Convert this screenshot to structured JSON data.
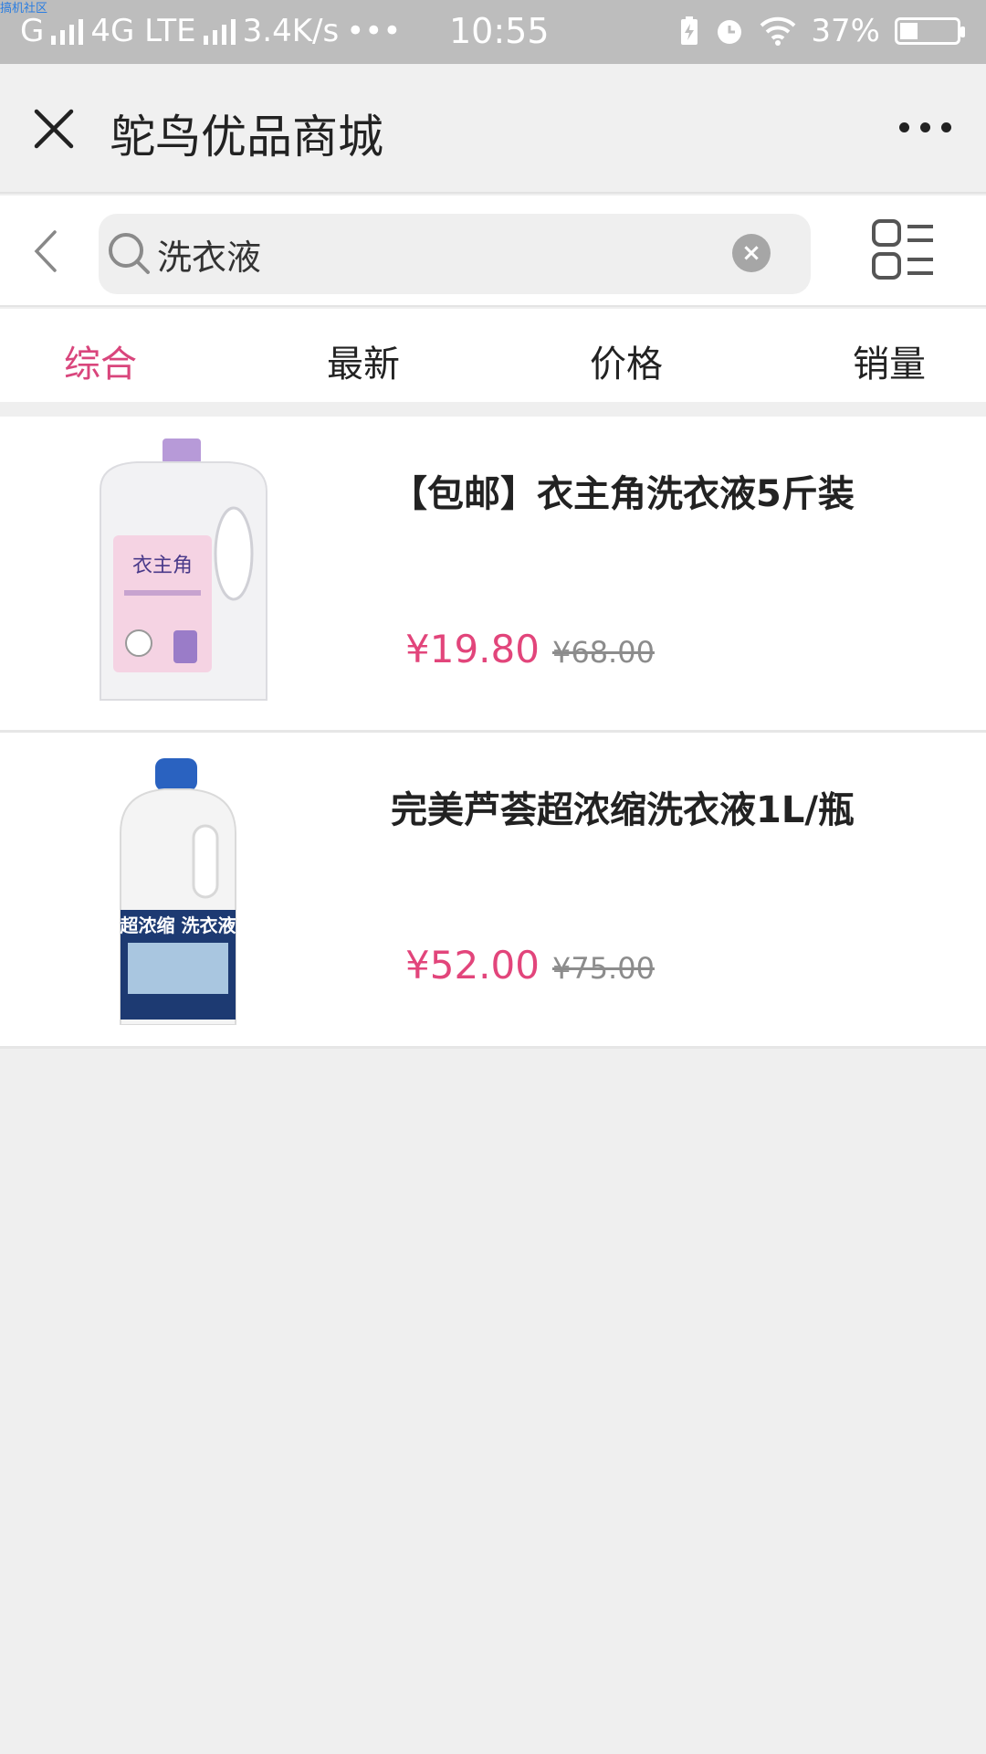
{
  "status_bar": {
    "watermark": "搞机社区",
    "carrier": "G",
    "network": "4G LTE",
    "speed": "3.4K/s",
    "dots": "•••",
    "time": "10:55",
    "battery": "37%"
  },
  "header": {
    "title": "鸵鸟优品商城"
  },
  "search": {
    "value": "洗衣液",
    "clear_label": "×"
  },
  "sort_tabs": [
    {
      "label": "综合",
      "active": true
    },
    {
      "label": "最新",
      "active": false
    },
    {
      "label": "价格",
      "active": false
    },
    {
      "label": "销量",
      "active": false
    }
  ],
  "products": [
    {
      "title": "【包邮】衣主角洗衣液5斤装",
      "price": "¥19.80",
      "original_price": "¥68.00",
      "image_text": "衣主角"
    },
    {
      "title": "完美芦荟超浓缩洗衣液1L/瓶",
      "price": "¥52.00",
      "original_price": "¥75.00",
      "image_text": "超浓缩 洗衣液"
    }
  ],
  "colors": {
    "accent": "#d9457c",
    "price": "#e2457b",
    "background": "#efefef"
  }
}
